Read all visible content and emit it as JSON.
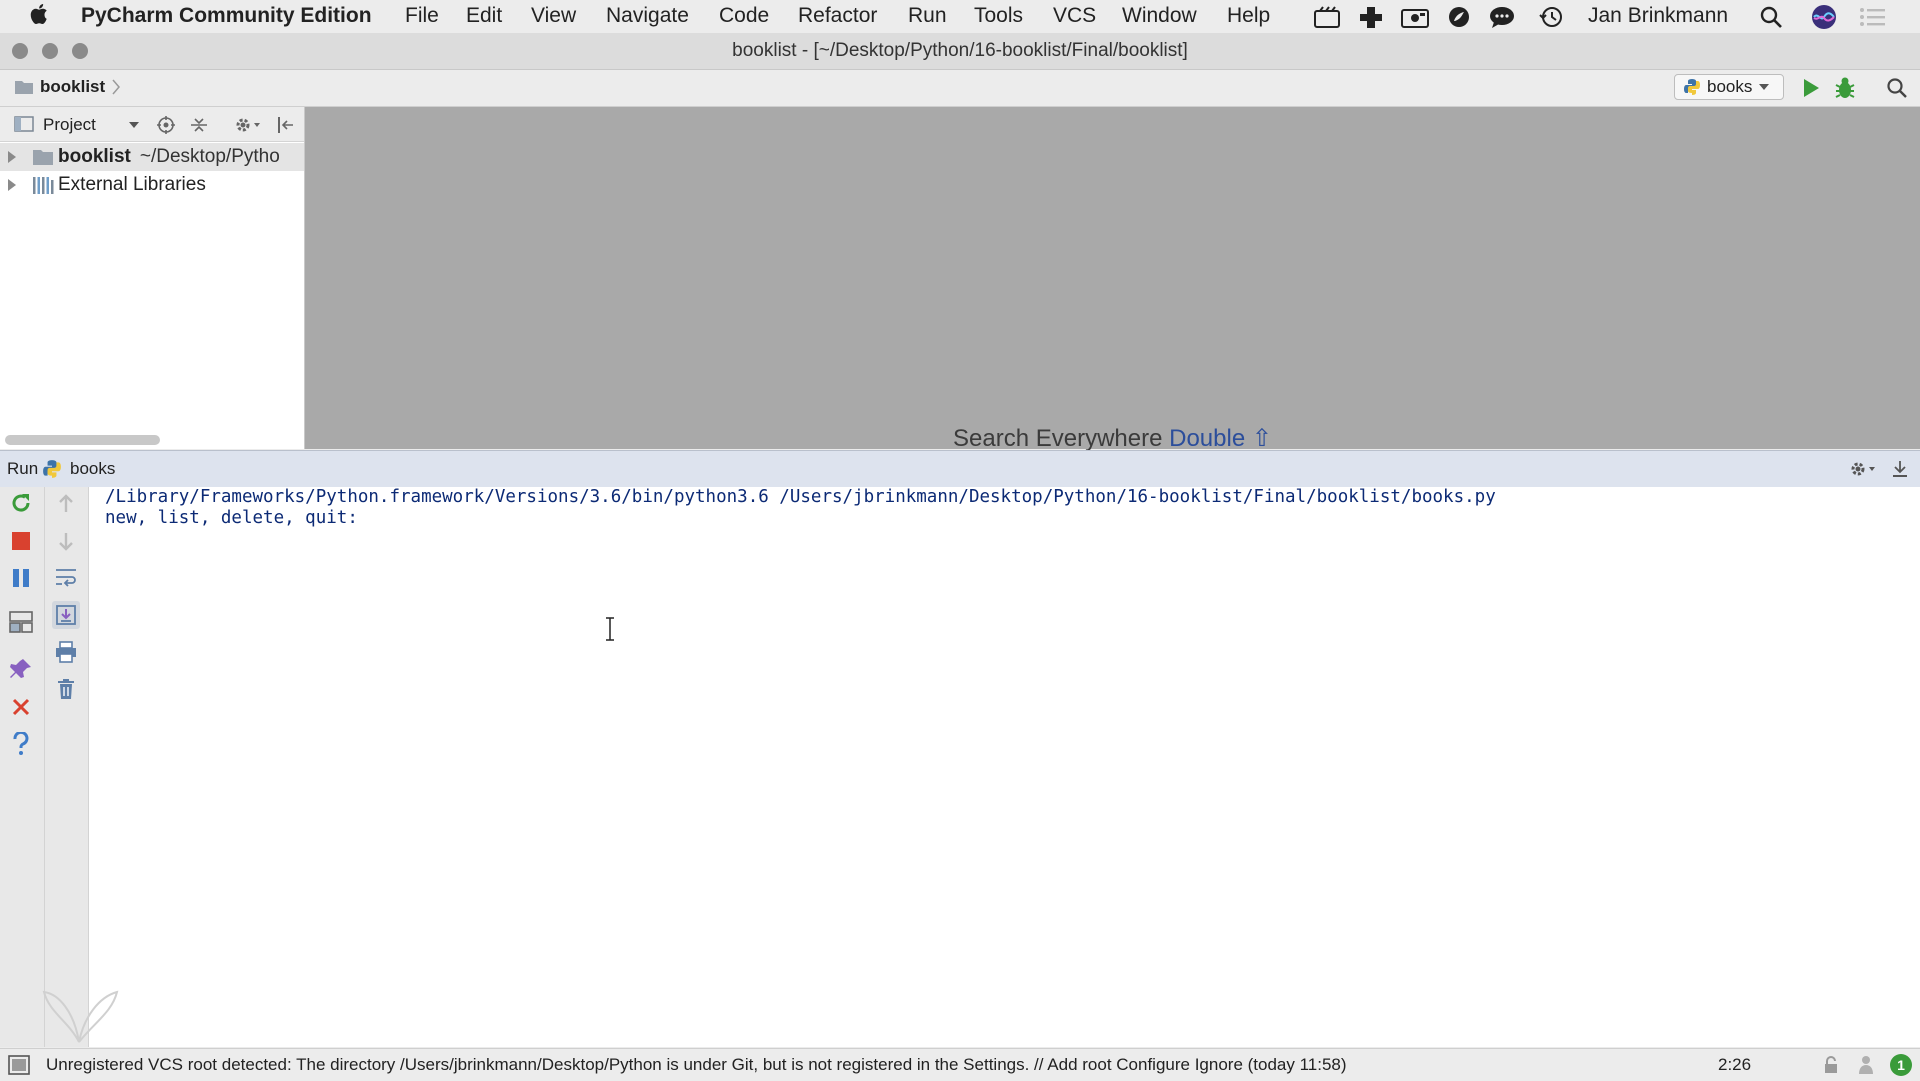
{
  "menubar": {
    "app_name": "PyCharm Community Edition",
    "items": [
      "File",
      "Edit",
      "View",
      "Navigate",
      "Code",
      "Refactor",
      "Run",
      "Tools",
      "VCS",
      "Window",
      "Help"
    ],
    "user": "Jan Brinkmann"
  },
  "window": {
    "title": "booklist - [~/Desktop/Python/16-booklist/Final/booklist]"
  },
  "navbar": {
    "breadcrumb": "booklist",
    "run_config": "books"
  },
  "project": {
    "view_label": "Project",
    "tree": [
      {
        "name": "booklist",
        "path": "~/Desktop/Pytho"
      },
      {
        "name": "External Libraries",
        "path": ""
      }
    ]
  },
  "editor": {
    "hint_text": "Search Everywhere",
    "hint_key": "Double ⇧"
  },
  "run": {
    "label": "Run",
    "config": "books",
    "console_lines": [
      "/Library/Frameworks/Python.framework/Versions/3.6/bin/python3.6 /Users/jbrinkmann/Desktop/Python/16-booklist/Final/booklist/books.py",
      "new, list, delete, quit:"
    ]
  },
  "status": {
    "message": "Unregistered VCS root detected: The directory /Users/jbrinkmann/Desktop/Python is under Git, but is not registered in the Settings. // Add root  Configure  Ignore (today 11:58)",
    "caret_position": "2:26",
    "notification_count": "1"
  },
  "colors": {
    "run_green": "#3a9b3a",
    "stop_red": "#d9412f",
    "console_text": "#0c2a75",
    "hint_key": "#2c4e9b"
  }
}
